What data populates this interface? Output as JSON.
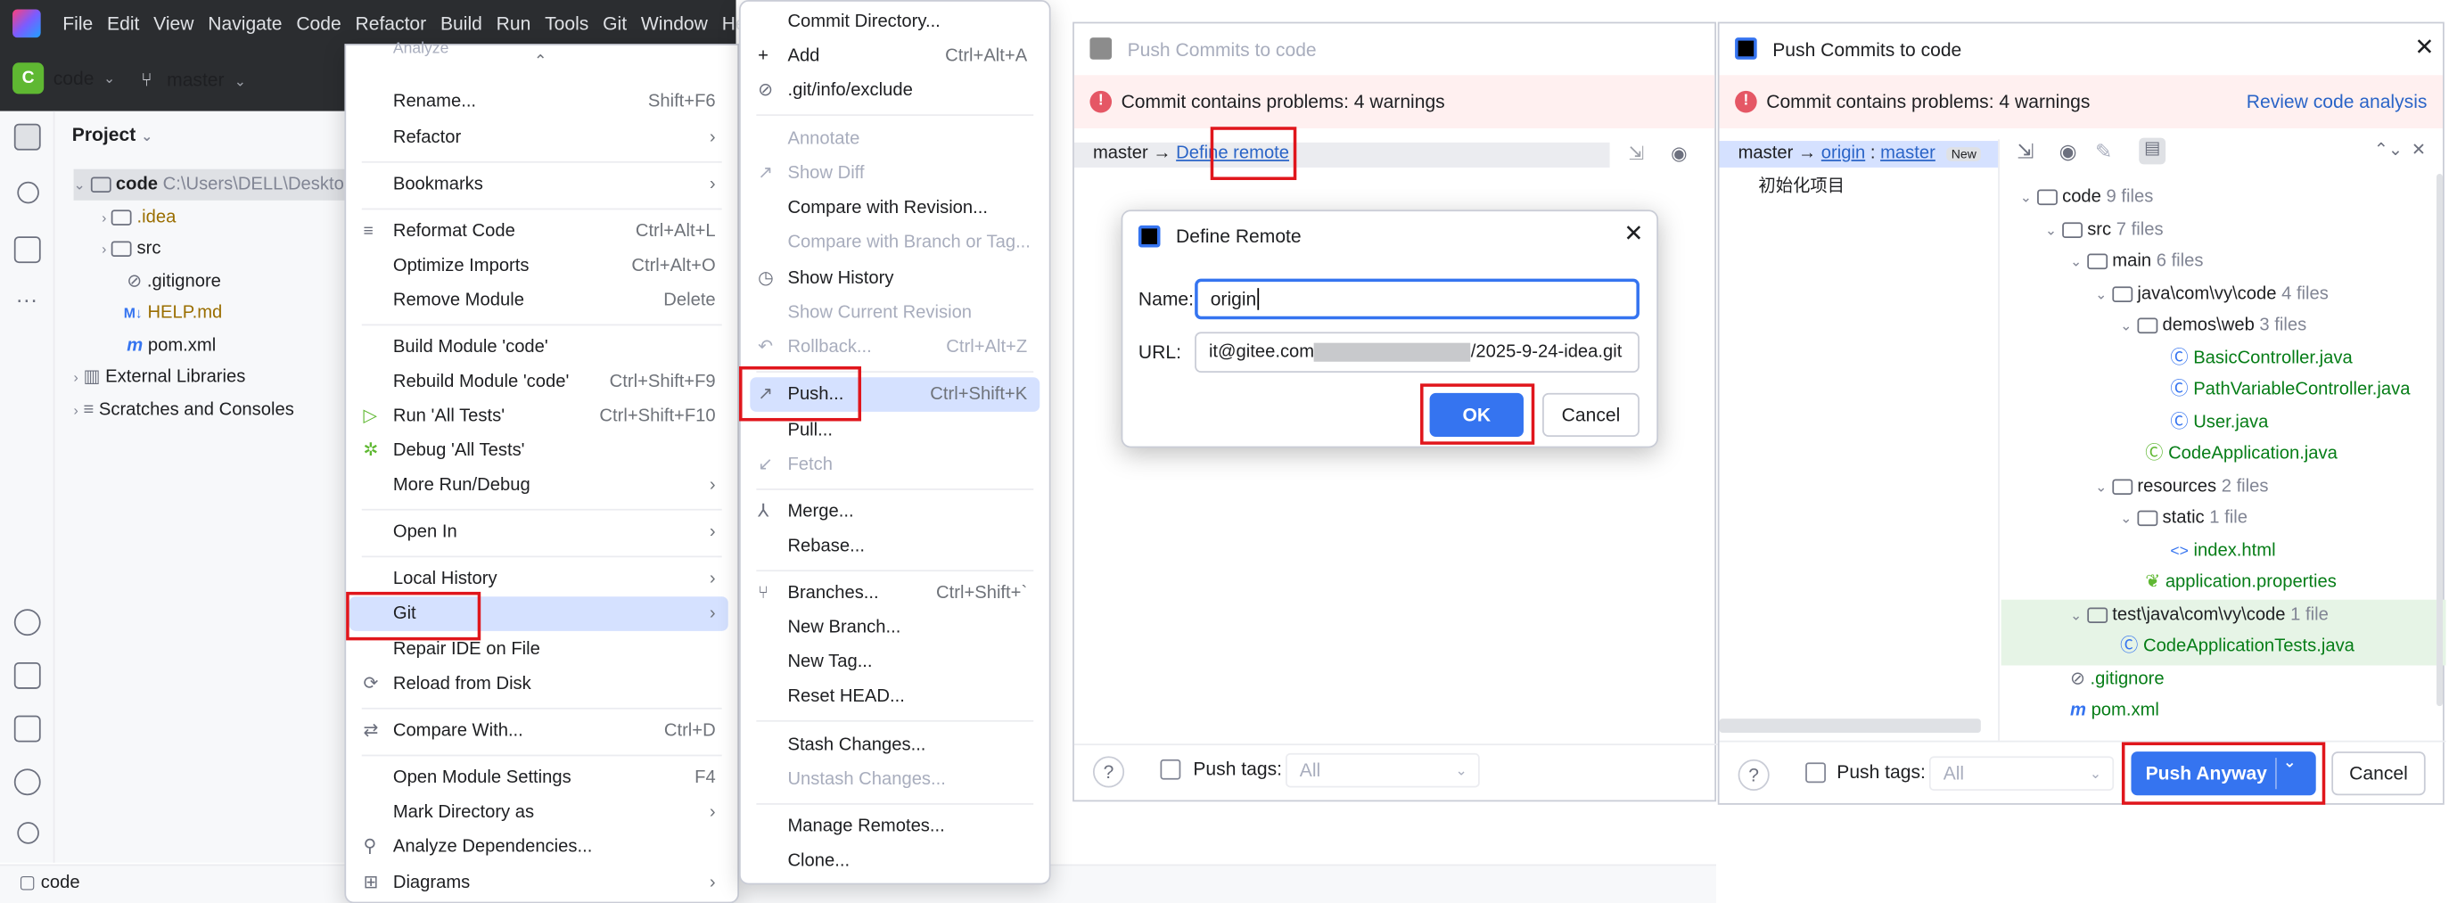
{
  "ide": {
    "menu": [
      "File",
      "Edit",
      "View",
      "Navigate",
      "Code",
      "Refactor",
      "Build",
      "Run",
      "Tools",
      "Git",
      "Window",
      "He"
    ],
    "project_chip": "code",
    "project_letter": "C",
    "branch": "master",
    "project_label": "Project",
    "tree": [
      {
        "label": "code",
        "hint": "C:\\Users\\DELL\\Desktop\\"
      },
      {
        "label": ".idea"
      },
      {
        "label": "src"
      },
      {
        "label": ".gitignore"
      },
      {
        "label": "HELP.md"
      },
      {
        "label": "pom.xml"
      },
      {
        "label": "External Libraries"
      },
      {
        "label": "Scratches and Consoles"
      }
    ],
    "status": "code"
  },
  "context_menu": {
    "items": [
      {
        "label": "Analyze"
      },
      {
        "label": "Rename...",
        "shortcut": "Shift+F6"
      },
      {
        "label": "Refactor",
        "submenu": "›"
      },
      {
        "label": "Bookmarks",
        "submenu": "›"
      },
      {
        "label": "Reformat Code",
        "shortcut": "Ctrl+Alt+L"
      },
      {
        "label": "Optimize Imports",
        "shortcut": "Ctrl+Alt+O"
      },
      {
        "label": "Remove Module",
        "shortcut": "Delete"
      },
      {
        "label": "Build Module 'code'"
      },
      {
        "label": "Rebuild Module 'code'",
        "shortcut": "Ctrl+Shift+F9"
      },
      {
        "label": "Run 'All Tests'",
        "shortcut": "Ctrl+Shift+F10"
      },
      {
        "label": "Debug 'All Tests'"
      },
      {
        "label": "More Run/Debug",
        "submenu": "›"
      },
      {
        "label": "Open In",
        "submenu": "›"
      },
      {
        "label": "Local History",
        "submenu": "›"
      },
      {
        "label": "Git",
        "submenu": "›"
      },
      {
        "label": "Repair IDE on File"
      },
      {
        "label": "Reload from Disk"
      },
      {
        "label": "Compare With...",
        "shortcut": "Ctrl+D"
      },
      {
        "label": "Open Module Settings",
        "shortcut": "F4"
      },
      {
        "label": "Mark Directory as",
        "submenu": "›"
      },
      {
        "label": "Analyze Dependencies..."
      },
      {
        "label": "Diagrams",
        "submenu": "›"
      }
    ]
  },
  "git_menu": {
    "items": [
      {
        "label": "Commit Directory..."
      },
      {
        "label": "Add",
        "shortcut": "Ctrl+Alt+A"
      },
      {
        "label": ".git/info/exclude"
      },
      {
        "label": "Annotate"
      },
      {
        "label": "Show Diff"
      },
      {
        "label": "Compare with Revision..."
      },
      {
        "label": "Compare with Branch or Tag..."
      },
      {
        "label": "Show History"
      },
      {
        "label": "Show Current Revision"
      },
      {
        "label": "Rollback...",
        "shortcut": "Ctrl+Alt+Z"
      },
      {
        "label": "Push...",
        "shortcut": "Ctrl+Shift+K"
      },
      {
        "label": "Pull..."
      },
      {
        "label": "Fetch"
      },
      {
        "label": "Merge..."
      },
      {
        "label": "Rebase..."
      },
      {
        "label": "Branches...",
        "shortcut": "Ctrl+Shift+`"
      },
      {
        "label": "New Branch..."
      },
      {
        "label": "New Tag..."
      },
      {
        "label": "Reset HEAD..."
      },
      {
        "label": "Stash Changes..."
      },
      {
        "label": "Unstash Changes..."
      },
      {
        "label": "Manage Remotes..."
      },
      {
        "label": "Clone..."
      }
    ]
  },
  "push_dialog_left": {
    "title": "Push Commits to code",
    "warning": "Commit contains problems: 4 warnings",
    "branch": "master",
    "arrow": "→",
    "define_remote": "Define remote",
    "push_tags": "Push tags:",
    "tags_value": "All",
    "help": "?"
  },
  "define_remote": {
    "title": "Define Remote",
    "name_label": "Name:",
    "name_value": "origin",
    "url_label": "URL:",
    "url_prefix": "it@gitee.com",
    "url_suffix": "/2025-9-24-idea.git",
    "ok": "OK",
    "cancel": "Cancel"
  },
  "push_dialog_right": {
    "title": "Push Commits to code",
    "warning": "Commit contains problems: 4 warnings",
    "review_link": "Review code analysis",
    "branch": "master",
    "arrow": "→",
    "remote": "origin",
    "colon": ":",
    "remote_branch": "master",
    "new_badge": "New",
    "commit_msg": "初始化项目",
    "tree": [
      {
        "label": "code",
        "count": "9 files"
      },
      {
        "label": "src",
        "count": "7 files"
      },
      {
        "label": "main",
        "count": "6 files"
      },
      {
        "label": "java\\com\\vy\\code",
        "count": "4 files"
      },
      {
        "label": "demos\\web",
        "count": "3 files"
      },
      {
        "label": "BasicController.java"
      },
      {
        "label": "PathVariableController.java"
      },
      {
        "label": "User.java"
      },
      {
        "label": "CodeApplication.java"
      },
      {
        "label": "resources",
        "count": "2 files"
      },
      {
        "label": "static",
        "count": "1 file"
      },
      {
        "label": "index.html"
      },
      {
        "label": "application.properties"
      },
      {
        "label": "test\\java\\com\\vy\\code",
        "count": "1 file"
      },
      {
        "label": "CodeApplicationTests.java"
      },
      {
        "label": ".gitignore"
      },
      {
        "label": "pom.xml"
      }
    ],
    "push_tags": "Push tags:",
    "tags_value": "All",
    "push_anyway": "Push Anyway",
    "cancel": "Cancel",
    "help": "?"
  },
  "colors": {
    "accent": "#3574f0",
    "highlight": "#e0161c",
    "warn_bg": "#fff0f0",
    "file_green": "#067d17"
  }
}
